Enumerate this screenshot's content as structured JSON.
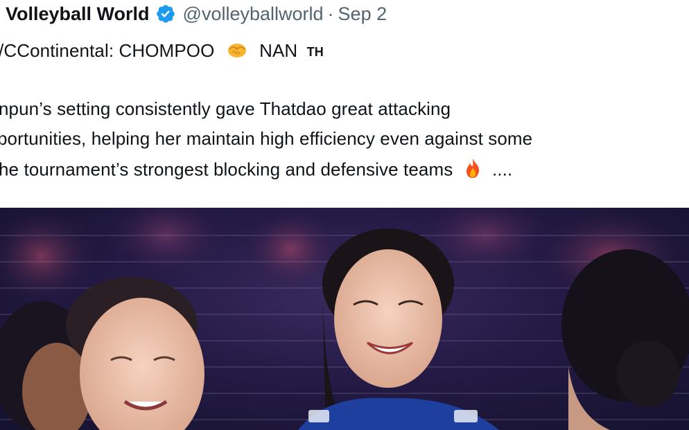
{
  "tweet": {
    "display_name": "Volleyball World",
    "handle": "@volleyballworld",
    "separator": "·",
    "date": "Sep 2",
    "line1": "/CContinental: CHOMPOO",
    "line1_partner": "NAN",
    "line1_flag": "TH",
    "line2": "npun’s setting consistently gave Thatdao great attacking",
    "line3": "portunities, helping her maintain high efficiency even against some",
    "line4": "he tournament’s strongest blocking and defensive teams",
    "line4_tail": "...."
  },
  "icons": {
    "verified": "verified-badge-icon",
    "handshake": "handshake-emoji-icon",
    "fire": "fire-emoji-icon"
  },
  "colors": {
    "verified_blue": "#1d9bf0",
    "text_primary": "#0f1419",
    "text_secondary": "#536471",
    "jersey_blue": "#1f3f9e"
  }
}
